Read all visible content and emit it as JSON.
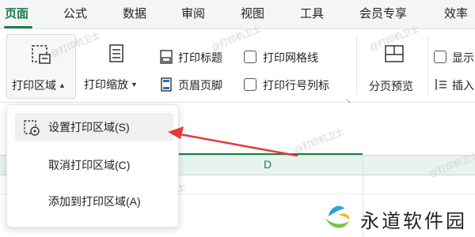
{
  "menu": {
    "tabs": [
      "页面",
      "公式",
      "数据",
      "审阅",
      "视图",
      "工具",
      "会员专享",
      "效率"
    ],
    "active_index": 0
  },
  "ribbon": {
    "print_area": "打印区域",
    "print_scale": "打印缩放",
    "print_titles": "打印标题",
    "header_footer": "页眉页脚",
    "print_gridlines": "打印网格线",
    "print_row_col": "打印行号列标",
    "page_break_preview": "分页预览",
    "show": "显示",
    "insert": "插入"
  },
  "dropdown": {
    "items": [
      "设置打印区域(S)",
      "取消打印区域(C)",
      "添加到打印区域(A)"
    ],
    "highlighted_index": 0
  },
  "sheet": {
    "column_label": "D"
  },
  "watermark": "@打印机卫士",
  "brand": {
    "text": "永道软件园"
  },
  "colors": {
    "accent": "#1a7f4b",
    "arrow": "#e53935"
  }
}
